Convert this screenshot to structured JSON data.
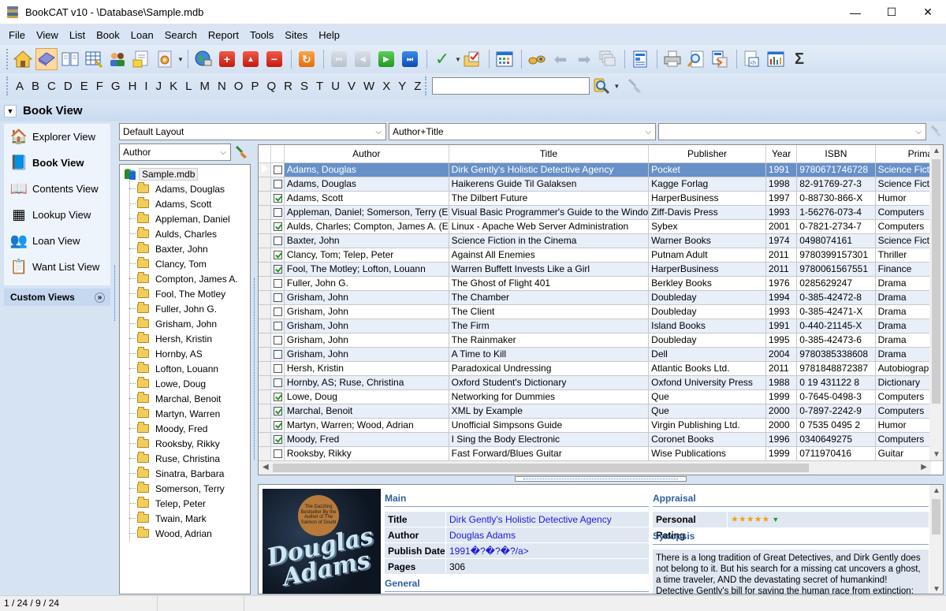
{
  "window": {
    "title": "BookCAT v10 - \\Database\\Sample.mdb",
    "controls": {
      "minimize": "—",
      "maximize": "☐",
      "close": "✕"
    }
  },
  "menu": [
    "File",
    "View",
    "List",
    "Book",
    "Loan",
    "Search",
    "Report",
    "Tools",
    "Sites",
    "Help"
  ],
  "toolbar": {
    "buttons": [
      {
        "name": "explorer-view-icon"
      },
      {
        "name": "book-view-icon",
        "active": true
      },
      {
        "name": "contents-view-icon"
      },
      {
        "name": "lookup-view-icon"
      },
      {
        "name": "loan-view-icon"
      },
      {
        "name": "want-list-view-icon"
      },
      {
        "name": "settings-icon"
      },
      {
        "name": "web-search-icon"
      },
      {
        "name": "add-icon",
        "glyph": "+"
      },
      {
        "name": "edit-up-icon",
        "glyph": "▲"
      },
      {
        "name": "delete-icon",
        "glyph": "−"
      },
      {
        "name": "refresh-icon",
        "glyph": "↻"
      },
      {
        "name": "first-record-icon",
        "glyph": "⏮"
      },
      {
        "name": "previous-record-icon",
        "glyph": "◀"
      },
      {
        "name": "next-record-icon",
        "glyph": "▶"
      },
      {
        "name": "last-record-icon",
        "glyph": "⏭"
      },
      {
        "name": "check-icon",
        "glyph": "✓"
      },
      {
        "name": "checklist-folder-icon"
      },
      {
        "name": "grid-icon"
      },
      {
        "name": "binoculars-icon"
      },
      {
        "name": "back-icon",
        "glyph": "⬅"
      },
      {
        "name": "forward-icon",
        "glyph": "➡"
      },
      {
        "name": "windows-icon"
      },
      {
        "name": "report-icon"
      },
      {
        "name": "print-icon"
      },
      {
        "name": "print-preview-icon"
      },
      {
        "name": "export-icon"
      },
      {
        "name": "html-export-icon",
        "glyph": "<h"
      },
      {
        "name": "statistics-chart-icon"
      },
      {
        "name": "sum-icon",
        "glyph": "Σ"
      }
    ]
  },
  "alphabet": [
    "A",
    "B",
    "C",
    "D",
    "E",
    "F",
    "G",
    "H",
    "I",
    "J",
    "K",
    "L",
    "M",
    "N",
    "O",
    "P",
    "Q",
    "R",
    "S",
    "T",
    "U",
    "V",
    "W",
    "X",
    "Y",
    "Z"
  ],
  "quick_search": {
    "value": "",
    "placeholder": ""
  },
  "view_header": {
    "title": "Book View"
  },
  "nav": {
    "items": [
      {
        "label": "Explorer View",
        "icon": "house-icon",
        "glyph": "🏠"
      },
      {
        "label": "Book View",
        "icon": "book-icon",
        "glyph": "📘",
        "active": true
      },
      {
        "label": "Contents View",
        "icon": "open-book-icon",
        "glyph": "📖"
      },
      {
        "label": "Lookup View",
        "icon": "table-edit-icon",
        "glyph": "▦"
      },
      {
        "label": "Loan View",
        "icon": "people-icon",
        "glyph": "👥"
      },
      {
        "label": "Want List View",
        "icon": "list-icon",
        "glyph": "📋"
      }
    ],
    "custom_views": "Custom Views"
  },
  "filters": {
    "layout": "Default Layout",
    "sort": "Author+Title",
    "extra": "",
    "tree_field": "Author"
  },
  "tree": {
    "root": "Sample.mdb",
    "items": [
      "Adams, Douglas",
      "Adams, Scott",
      "Appleman, Daniel",
      "Aulds, Charles",
      "Baxter, John",
      "Clancy, Tom",
      "Compton, James A.",
      "Fool, The Motley",
      "Fuller, John G.",
      "Grisham, John",
      "Hersh, Kristin",
      "Hornby, AS",
      "Lofton, Louann",
      "Lowe, Doug",
      "Marchal, Benoit",
      "Martyn, Warren",
      "Moody, Fred",
      "Rooksby, Rikky",
      "Ruse, Christina",
      "Sinatra, Barbara",
      "Somerson, Terry",
      "Telep, Peter",
      "Twain, Mark",
      "Wood, Adrian"
    ]
  },
  "grid": {
    "columns": [
      "Author",
      "Title",
      "Publisher",
      "Year",
      "ISBN",
      "Primary"
    ],
    "rows": [
      {
        "checked": false,
        "selected": true,
        "cells": [
          "Adams, Douglas",
          "Dirk Gently's Holistic Detective Agency",
          "Pocket",
          "1991",
          "9780671746728",
          "Science Fiction"
        ]
      },
      {
        "checked": false,
        "cells": [
          "Adams, Douglas",
          "Haikerens Guide Til Galaksen",
          "Kagge Forlag",
          "1998",
          "82-91769-27-3",
          "Science Fiction"
        ]
      },
      {
        "checked": true,
        "cells": [
          "Adams, Scott",
          "The Dilbert Future",
          "HarperBusiness",
          "1997",
          "0-88730-866-X",
          "Humor"
        ]
      },
      {
        "checked": false,
        "cells": [
          "Appleman, Daniel; Somerson, Terry (E",
          "Visual Basic Programmer's Guide to the Windo",
          "Ziff-Davis Press",
          "1993",
          "1-56276-073-4",
          "Computers"
        ]
      },
      {
        "checked": true,
        "cells": [
          "Aulds, Charles; Compton, James A. (E",
          "Linux - Apache Web Server Administration",
          "Sybex",
          "2001",
          "0-7821-2734-7",
          "Computers"
        ]
      },
      {
        "checked": false,
        "cells": [
          "Baxter, John",
          "Science Fiction in the Cinema",
          "Warner Books",
          "1974",
          "0498074161",
          "Science Fiction"
        ]
      },
      {
        "checked": true,
        "cells": [
          "Clancy, Tom; Telep, Peter",
          "Against All Enemies",
          "Putnam Adult",
          "2011",
          "9780399157301",
          "Thriller"
        ]
      },
      {
        "checked": true,
        "cells": [
          "Fool, The Motley; Lofton, Louann",
          "Warren Buffett Invests Like a Girl",
          "HarperBusiness",
          "2011",
          "9780061567551",
          "Finance"
        ]
      },
      {
        "checked": false,
        "cells": [
          "Fuller, John G.",
          "The Ghost of Flight 401",
          "Berkley Books",
          "1976",
          "0285629247",
          "Drama"
        ]
      },
      {
        "checked": false,
        "cells": [
          "Grisham, John",
          "The Chamber",
          "Doubleday",
          "1994",
          "0-385-42472-8",
          "Drama"
        ]
      },
      {
        "checked": false,
        "cells": [
          "Grisham, John",
          "The Client",
          "Doubleday",
          "1993",
          "0-385-42471-X",
          "Drama"
        ]
      },
      {
        "checked": false,
        "cells": [
          "Grisham, John",
          "The Firm",
          "Island Books",
          "1991",
          "0-440-21145-X",
          "Drama"
        ]
      },
      {
        "checked": false,
        "cells": [
          "Grisham, John",
          "The Rainmaker",
          "Doubleday",
          "1995",
          "0-385-42473-6",
          "Drama"
        ]
      },
      {
        "checked": false,
        "cells": [
          "Grisham, John",
          "A Time to Kill",
          "Dell",
          "2004",
          "9780385338608",
          "Drama"
        ]
      },
      {
        "checked": false,
        "cells": [
          "Hersh, Kristin",
          "Paradoxical Undressing",
          "Atlantic Books Ltd.",
          "2011",
          "9781848872387",
          "Autobiography"
        ]
      },
      {
        "checked": false,
        "cells": [
          "Hornby, AS; Ruse, Christina",
          "Oxford Student's Dictionary",
          "Oxfond University Press",
          "1988",
          "0 19 431122 8",
          "Dictionary"
        ]
      },
      {
        "checked": true,
        "cells": [
          "Lowe, Doug",
          "Networking for Dummies",
          "Que",
          "1999",
          "0-7645-0498-3",
          "Computers"
        ]
      },
      {
        "checked": true,
        "cells": [
          "Marchal, Benoit",
          "XML by Example",
          "Que",
          "2000",
          "0-7897-2242-9",
          "Computers"
        ]
      },
      {
        "checked": true,
        "cells": [
          "Martyn, Warren; Wood, Adrian",
          "Unofficial Simpsons Guide",
          "Virgin Publishing Ltd.",
          "2000",
          "0 7535 0495 2",
          "Humor"
        ]
      },
      {
        "checked": true,
        "cells": [
          "Moody, Fred",
          "I Sing the Body Electronic",
          "Coronet Books",
          "1996",
          "0340649275",
          "Computers"
        ]
      },
      {
        "checked": false,
        "cells": [
          "Rooksby, Rikky",
          "Fast Forward/Blues Guitar",
          "Wise Publications",
          "1999",
          "0711970416",
          "Guitar"
        ]
      }
    ]
  },
  "detail": {
    "cover": {
      "badge": "The Dazzling Bestseller By the Author of The Salmon of Doubt",
      "author_line1": "Douglas",
      "author_line2": "Adams"
    },
    "main_title": "Main",
    "fields": [
      {
        "label": "Title",
        "value": "Dirk Gently's Holistic Detective Agency",
        "link": true
      },
      {
        "label": "Author",
        "value": "Douglas Adams",
        "link": true
      },
      {
        "label": "Publish Date",
        "value": "1991�?�?�?/a>",
        "link": true
      },
      {
        "label": "Pages",
        "value": "306",
        "link": false
      }
    ],
    "general_title": "General",
    "appraisal_title": "Appraisal",
    "rating_label": "Personal Rating",
    "rating_value": 5,
    "rating_max": 5,
    "rating_stars": "★★★★★",
    "synopsis_title": "Synopsis",
    "synopsis": "There is a long tradition of Great Detectives, and Dirk Gently does not belong to it. But his search for a missing cat uncovers a ghost, a time traveler, AND the devastating secret of humankind! Detective Gently's bill for saving the human race from extinction: NO CHARGE."
  },
  "status": {
    "record": "1 / 24 / 9 / 24"
  }
}
